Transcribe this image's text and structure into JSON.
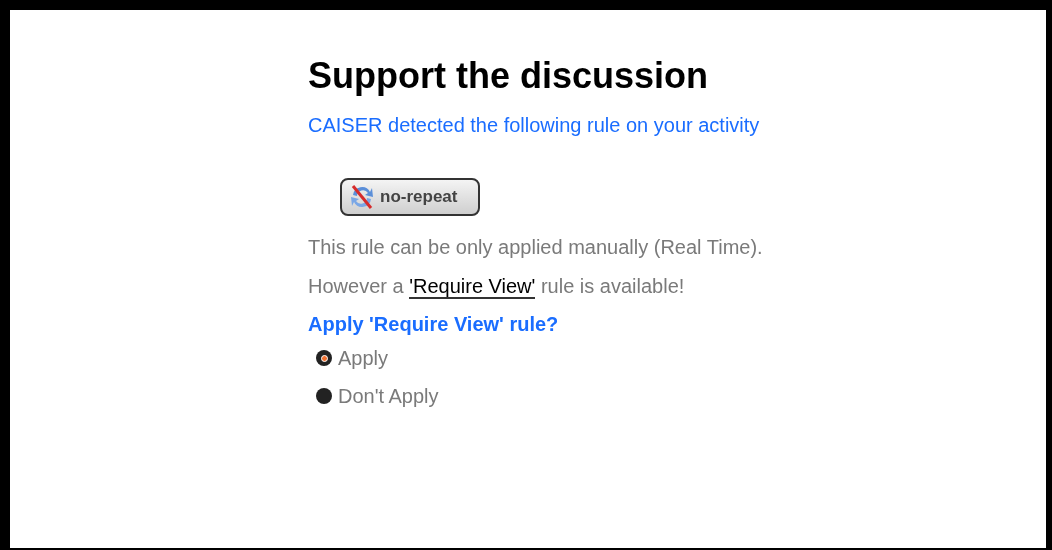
{
  "title": "Support the discussion",
  "subtitle": "CAISER detected the following rule on your activity",
  "rule_badge": {
    "label": "no-repeat"
  },
  "note": "This rule can be only applied manually (Real Time).",
  "alternative": {
    "before": "However a ",
    "link": "'Require View'",
    "after": " rule is available!"
  },
  "question": "Apply 'Require View' rule?",
  "options": [
    {
      "label": "Apply",
      "selected": true
    },
    {
      "label": "Don't Apply",
      "selected": false
    }
  ]
}
